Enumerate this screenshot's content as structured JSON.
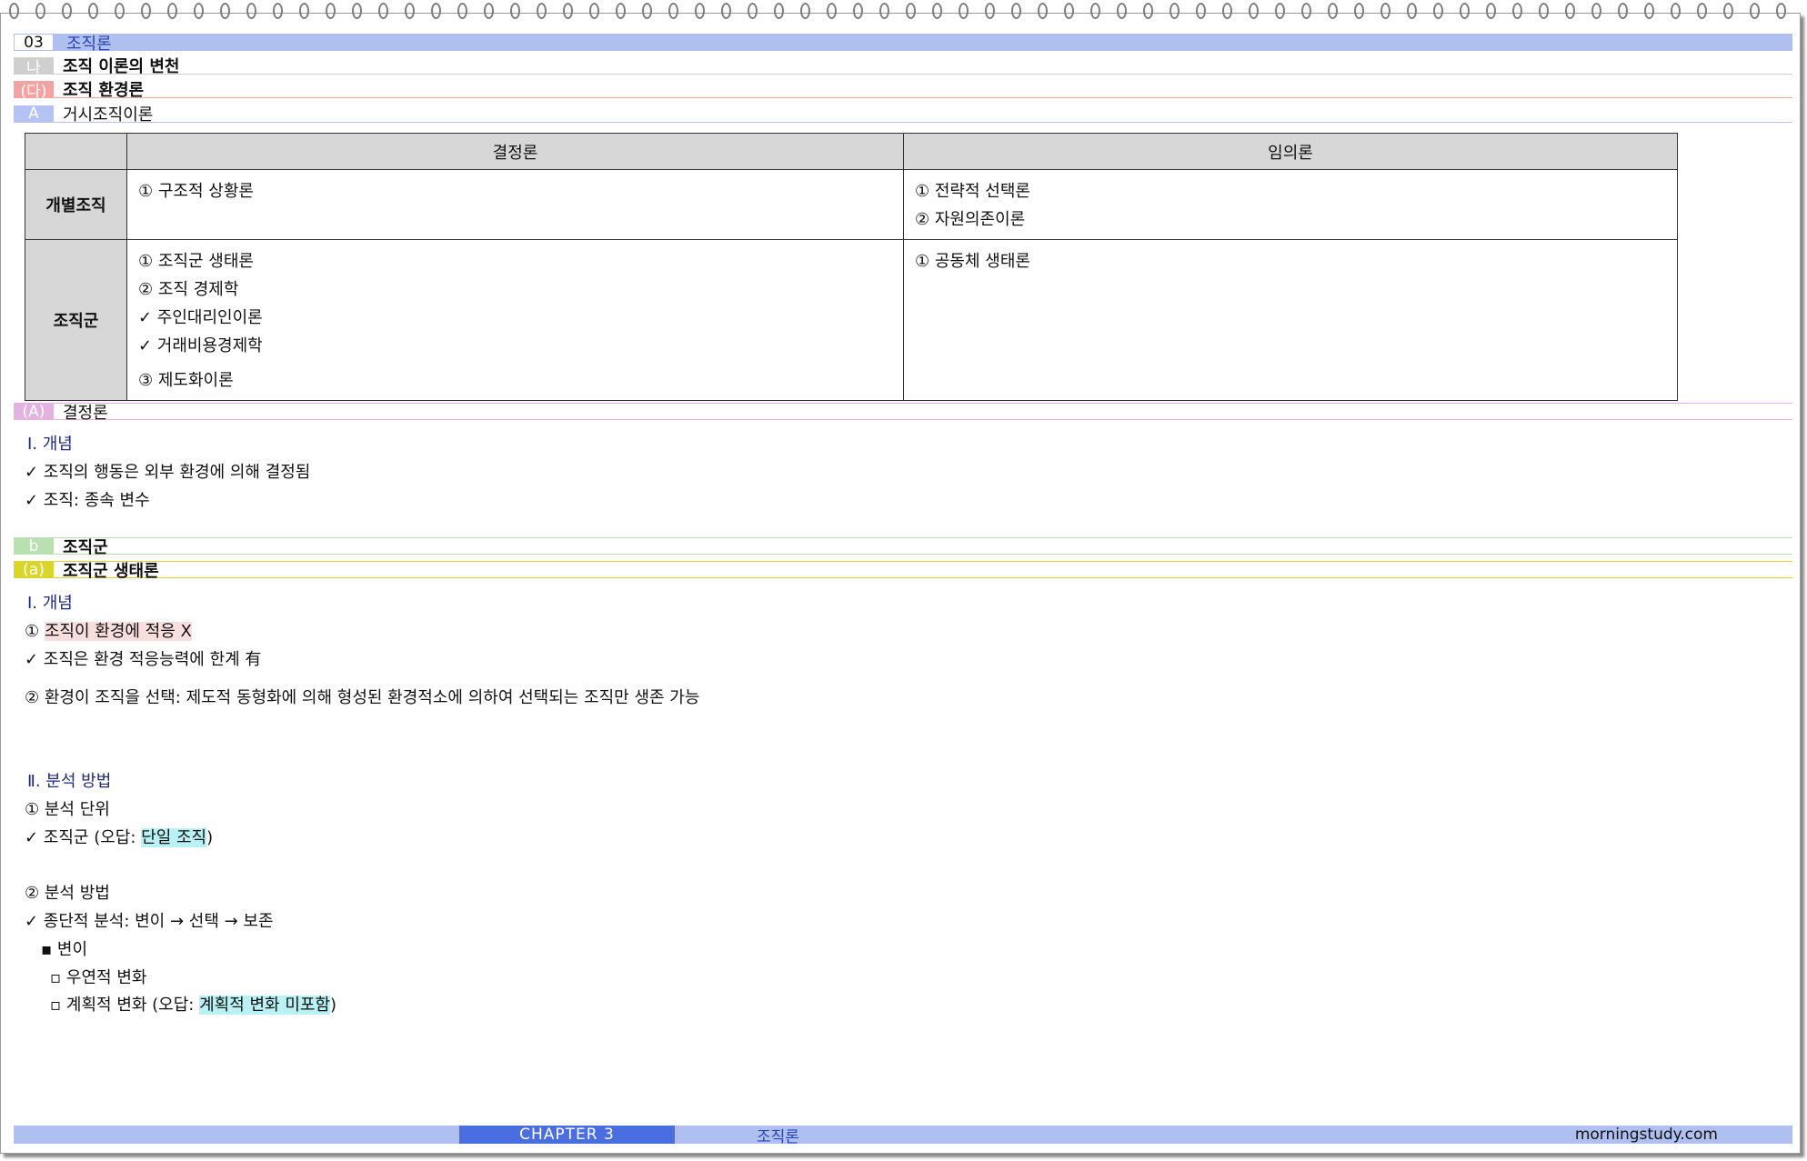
{
  "headers": {
    "h1": {
      "num": "03",
      "title": "조직론",
      "color": "#aebff0"
    },
    "h2": {
      "tag": "나",
      "title": "조직 이론의 변천",
      "color": "#cfcfcf"
    },
    "h3": {
      "tag": "(다)",
      "title": "조직 환경론",
      "color": "#f4a3a3"
    },
    "h4": {
      "tag": "A",
      "title": "거시조직이론",
      "color": "#b4c3f4"
    },
    "h5": {
      "tag": "(A)",
      "title": "결정론",
      "color": "#e2b2e0"
    },
    "h6": {
      "tag": "b",
      "title": "조직군",
      "color": "#b8e0b0"
    },
    "h7": {
      "tag": "(a)",
      "title": "조직군 생태론",
      "color": "#d9d52b"
    }
  },
  "table": {
    "col1": "결정론",
    "col2": "임의론",
    "row1": {
      "label": "개별조직",
      "c1": [
        "① 구조적 상황론"
      ],
      "c2": [
        "① 전략적 선택론",
        "② 자원의존이론"
      ]
    },
    "row2": {
      "label": "조직군",
      "c1": [
        "① 조직군 생태론",
        "② 조직 경제학",
        "✓ 주인대리인이론",
        "✓ 거래비용경제학",
        "③ 제도화이론"
      ],
      "c2": [
        "① 공동체 생태론"
      ]
    }
  },
  "determinism": {
    "heading": "Ⅰ. 개념",
    "l1": "✓ 조직의 행동은 외부 환경에 의해 결정됨",
    "l2": "✓ 조직: 종속 변수"
  },
  "ecology": {
    "heading1": "Ⅰ. 개념",
    "l1_prefix": "① ",
    "l1_hl": "조직이 환경에 적응 X",
    "l2": "✓ 조직은 환경 적응능력에 한계 有",
    "l3": "② 환경이 조직을 선택: 제도적 동형화에 의해 형성된 환경적소에 의하여 선택되는 조직만 생존 가능",
    "heading2": "Ⅱ. 분석 방법",
    "m1": "① 분석 단위",
    "m2_prefix": "✓ 조직군 (오답: ",
    "m2_hl": "단일 조직",
    "m2_suffix": ")",
    "m3": "② 분석 방법",
    "m4": "✓ 종단적 분석: 변이 → 선택 → 보존",
    "m5": "▪ 변이",
    "m6": "▫ 우연적 변화",
    "m7_prefix": "▫ 계획적 변화 (오답: ",
    "m7_hl": "계획적 변화 미포함",
    "m7_suffix": ")"
  },
  "footer": {
    "chapter": "CHAPTER  3",
    "title": "조직론",
    "site": "morningstudy.com"
  }
}
